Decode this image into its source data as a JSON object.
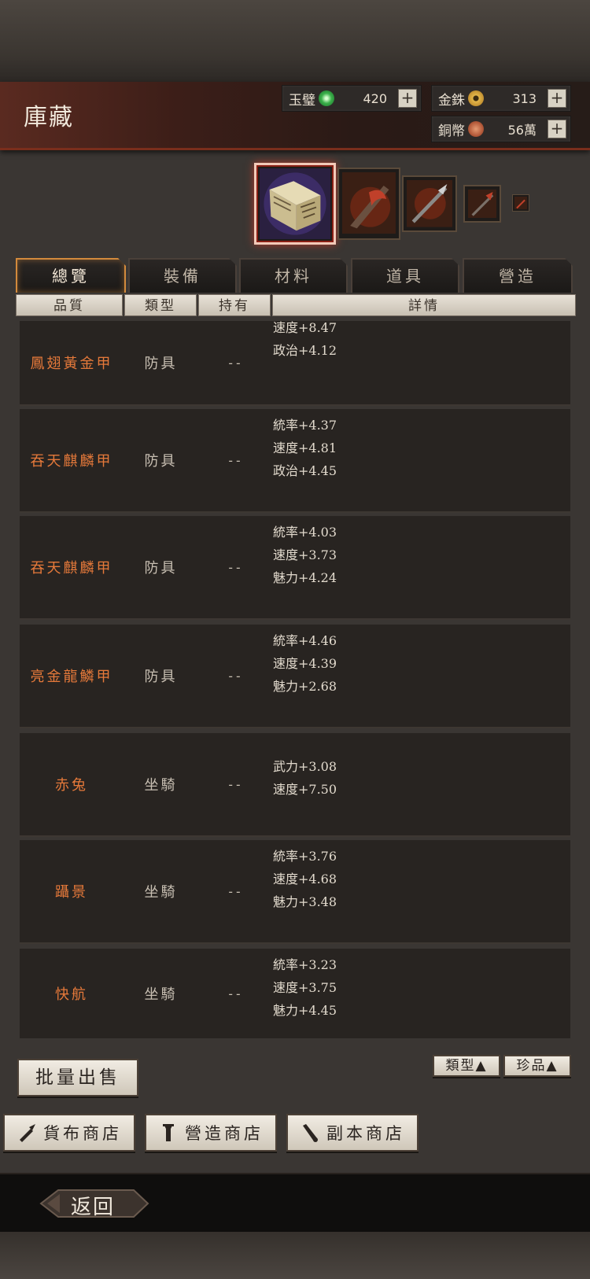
{
  "title": "庫藏",
  "currencies": [
    {
      "label": "玉璧",
      "value": "420",
      "icon": "jade-coin-icon",
      "color": "#3bb04a"
    },
    {
      "label": "金銖",
      "value": "313",
      "icon": "gold-coin-icon",
      "color": "#e3b64a"
    },
    {
      "label": "銅幣",
      "value": "56萬",
      "icon": "copper-coin-icon",
      "color": "#b45a3a"
    }
  ],
  "tabs": [
    "總覽",
    "裝備",
    "材料",
    "道具",
    "營造"
  ],
  "active_tab": "總覽",
  "columns": [
    "品質",
    "類型",
    "持有",
    "詳情"
  ],
  "items": [
    {
      "name": "鳳翅黃金甲",
      "type": "防具",
      "owner": "--",
      "stats": [
        "速度+8.47",
        "政治+4.12"
      ]
    },
    {
      "name": "吞天麒麟甲",
      "type": "防具",
      "owner": "--",
      "stats": [
        "統率+4.37",
        "速度+4.81",
        "政治+4.45"
      ]
    },
    {
      "name": "吞天麒麟甲",
      "type": "防具",
      "owner": "--",
      "stats": [
        "統率+4.03",
        "速度+3.73",
        "魅力+4.24"
      ]
    },
    {
      "name": "亮金龍鱗甲",
      "type": "防具",
      "owner": "--",
      "stats": [
        "統率+4.46",
        "速度+4.39",
        "魅力+2.68"
      ]
    },
    {
      "name": "赤兔",
      "type": "坐騎",
      "owner": "--",
      "stats": [
        "武力+3.08",
        "速度+7.50"
      ]
    },
    {
      "name": "躡景",
      "type": "坐騎",
      "owner": "--",
      "stats": [
        "統率+3.76",
        "速度+4.68",
        "魅力+3.48"
      ]
    },
    {
      "name": "快航",
      "type": "坐騎",
      "owner": "--",
      "stats": [
        "統率+3.23",
        "速度+3.75",
        "魅力+4.45"
      ]
    }
  ],
  "buttons": {
    "bulk_sell": "批量出售",
    "sort_type": "類型▲",
    "sort_rare": "珍品▲",
    "shop_currency": "貨布商店",
    "shop_build": "營造商店",
    "shop_dungeon": "副本商店",
    "back": "返回"
  },
  "colors": {
    "accent": "#d38a3c",
    "item_name": "#e5793a",
    "header_red": "#7a2e1c"
  }
}
